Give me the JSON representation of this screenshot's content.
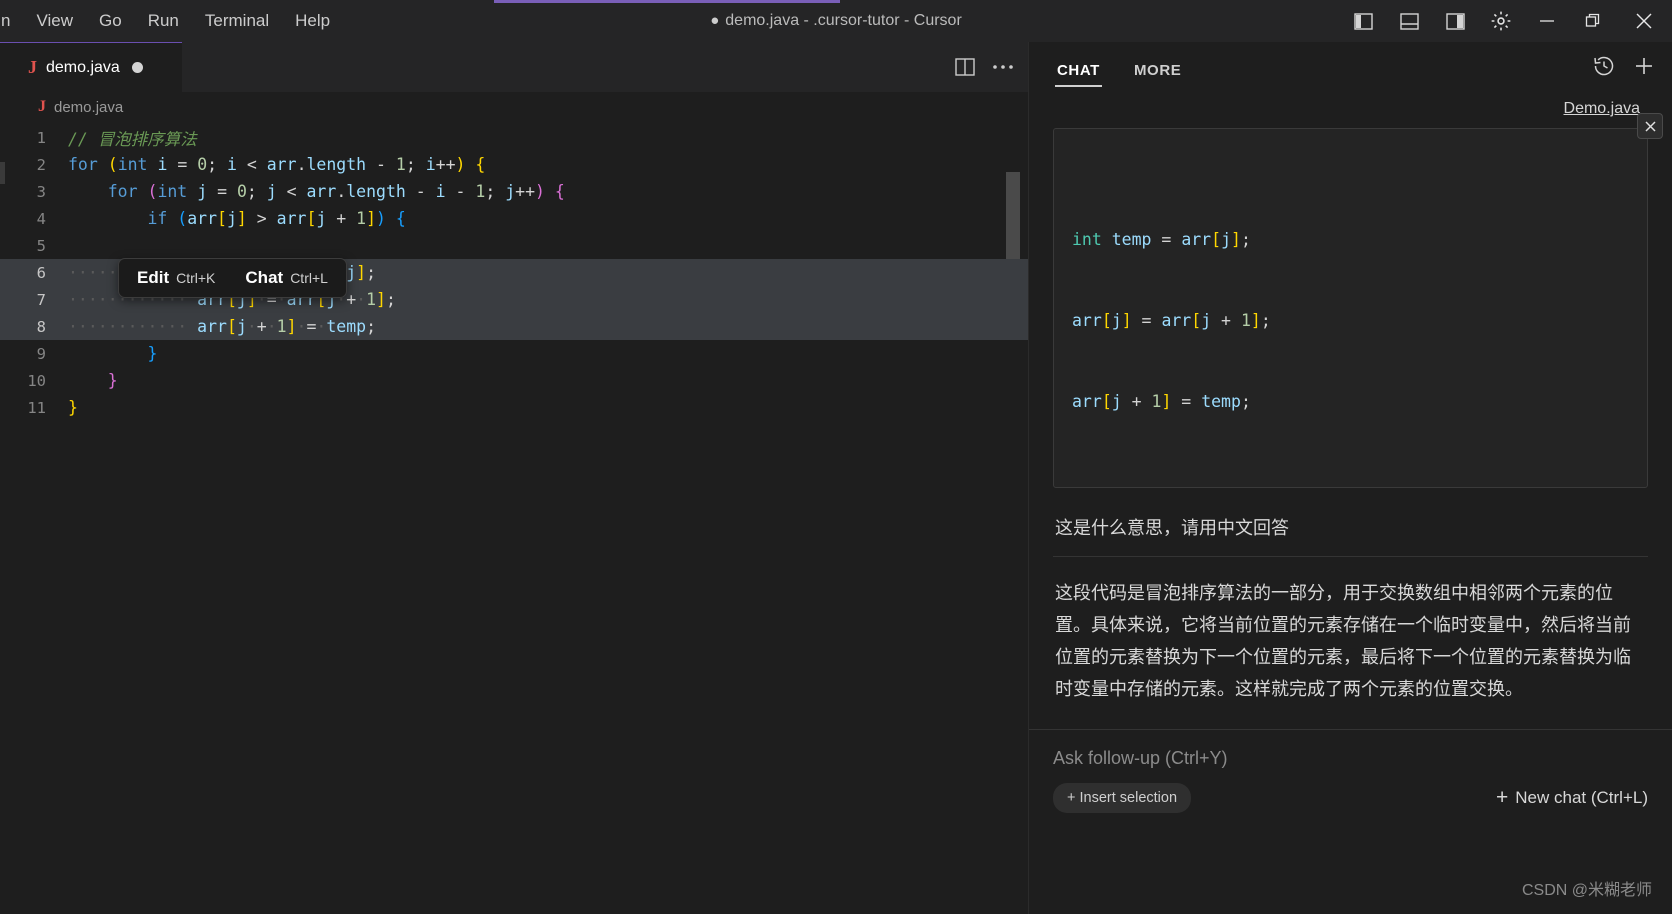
{
  "titlebar": {
    "menu": [
      "n",
      "View",
      "Go",
      "Run",
      "Terminal",
      "Help"
    ],
    "title": "demo.java - .cursor-tutor - Cursor",
    "dirty_dot": "●",
    "controls": [
      {
        "name": "toggle-primary-sidebar",
        "label": "Toggle Primary Side Bar"
      },
      {
        "name": "toggle-panel",
        "label": "Toggle Panel"
      },
      {
        "name": "toggle-secondary-sidebar",
        "label": "Toggle Secondary Side Bar"
      },
      {
        "name": "settings-gear",
        "label": "Settings"
      },
      {
        "name": "minimize",
        "label": "Minimize"
      },
      {
        "name": "maximize",
        "label": "Restore"
      },
      {
        "name": "close",
        "label": "Close"
      }
    ]
  },
  "editor": {
    "tab": {
      "icon": "J",
      "filename": "demo.java",
      "dirty": true
    },
    "breadcrumb": {
      "icon": "J",
      "text": "demo.java"
    },
    "tab_actions": [
      "split-editor",
      "more-actions"
    ],
    "lines": [
      {
        "n": "1",
        "selected": false
      },
      {
        "n": "2",
        "selected": false
      },
      {
        "n": "3",
        "selected": false
      },
      {
        "n": "4",
        "selected": false
      },
      {
        "n": "5",
        "selected": false
      },
      {
        "n": "6",
        "selected": true
      },
      {
        "n": "7",
        "selected": true
      },
      {
        "n": "8",
        "selected": true
      },
      {
        "n": "9",
        "selected": false
      },
      {
        "n": "10",
        "selected": false
      },
      {
        "n": "11",
        "selected": false
      }
    ],
    "source": [
      "// 冒泡排序算法",
      "for (int i = 0; i < arr.length - 1; i++) {",
      "    for (int j = 0; j < arr.length - i - 1; j++) {",
      "        if (arr[j] > arr[j + 1]) {",
      "",
      "            int temp = arr[j];",
      "            arr[j] = arr[j + 1];",
      "            arr[j + 1] = temp;",
      "        }",
      "    }",
      "}"
    ],
    "inline_popup": {
      "edit_label": "Edit",
      "edit_key": "Ctrl+K",
      "chat_label": "Chat",
      "chat_key": "Ctrl+L"
    }
  },
  "chat": {
    "tabs": [
      {
        "label": "CHAT",
        "active": true
      },
      {
        "label": "MORE",
        "active": false
      }
    ],
    "header_actions": [
      "history-icon",
      "new-chat-icon"
    ],
    "context_file": "Demo.java",
    "code_snippet": [
      "int temp = arr[j];",
      "arr[j] = arr[j + 1];",
      "arr[j + 1] = temp;"
    ],
    "user_message": "这是什么意思，请用中文回答",
    "ai_message": "这段代码是冒泡排序算法的一部分，用于交换数组中相邻两个元素的位置。具体来说，它将当前位置的元素存储在一个临时变量中，然后将当前位置的元素替换为下一个位置的元素，最后将下一个位置的元素替换为临时变量中存储的元素。这样就完成了两个元素的位置交换。",
    "input_placeholder": "Ask follow-up (Ctrl+Y)",
    "insert_selection_label": "+ Insert selection",
    "new_chat_label": "New chat (Ctrl+L)",
    "new_chat_plus": "+"
  },
  "watermark": "CSDN @米糊老师",
  "colors": {
    "accent_purple": "#7a5fb8",
    "java_icon_red": "#e0534e",
    "selection_bg": "#3a3d41",
    "editor_bg": "#1e1e1e",
    "chrome_bg": "#252526"
  }
}
